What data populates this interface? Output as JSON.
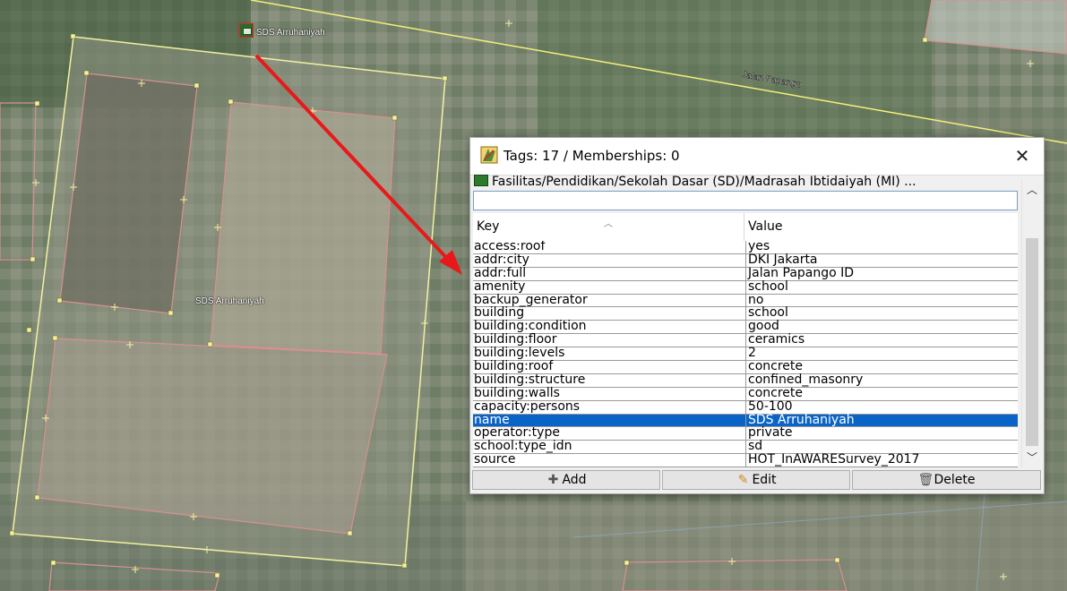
{
  "map": {
    "road_label": "Jalan Papango",
    "poi_label_top": "SDS Arruhaniyah",
    "poi_label_center": "SDS Arruhaniyah",
    "colors": {
      "building_outline": "#f4f0a0",
      "sub_outline": "#d99090",
      "arrow": "#e8191a"
    }
  },
  "dialog": {
    "title": "Tags: 17 / Memberships: 0",
    "close_icon": "close-icon",
    "preset_path": "Fasilitas/Pendidikan/Sekolah Dasar (SD)/Madrasah Ibtidaiyah (MI) ...",
    "search": {
      "value": "",
      "placeholder": ""
    },
    "columns": {
      "key": "Key",
      "value": "Value"
    },
    "rows": [
      {
        "key": "access:roof",
        "value": "yes"
      },
      {
        "key": "addr:city",
        "value": "DKI Jakarta"
      },
      {
        "key": "addr:full",
        "value": "Jalan Papango ID"
      },
      {
        "key": "amenity",
        "value": "school"
      },
      {
        "key": "backup_generator",
        "value": "no"
      },
      {
        "key": "building",
        "value": "school"
      },
      {
        "key": "building:condition",
        "value": "good"
      },
      {
        "key": "building:floor",
        "value": "ceramics"
      },
      {
        "key": "building:levels",
        "value": "2"
      },
      {
        "key": "building:roof",
        "value": "concrete"
      },
      {
        "key": "building:structure",
        "value": "confined_masonry"
      },
      {
        "key": "building:walls",
        "value": "concrete"
      },
      {
        "key": "capacity:persons",
        "value": "50-100"
      },
      {
        "key": "name",
        "value": "SDS Arruhaniyah",
        "selected": true
      },
      {
        "key": "operator:type",
        "value": "private"
      },
      {
        "key": "school:type_idn",
        "value": "sd"
      },
      {
        "key": "source",
        "value": "HOT_InAWARESurvey_2017"
      }
    ],
    "buttons": {
      "add": "Add",
      "edit": "Edit",
      "delete": "Delete"
    },
    "selection_color": "#0a64c8"
  }
}
